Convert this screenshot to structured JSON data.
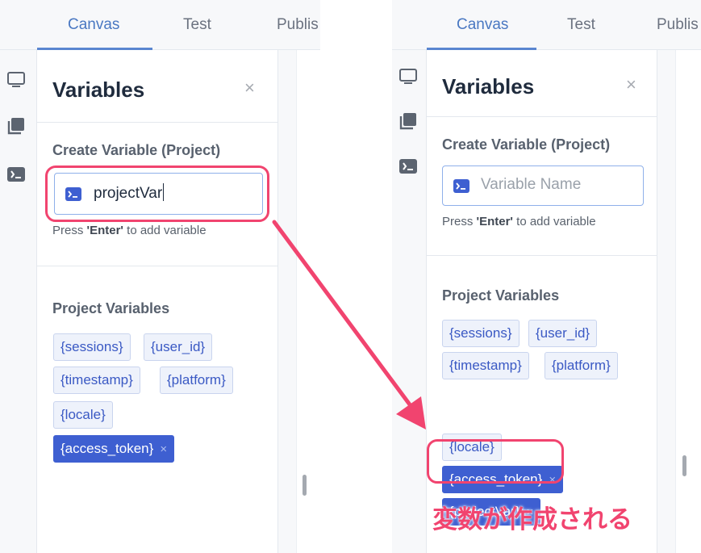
{
  "tabs": [
    "Canvas",
    "Test",
    "Publis"
  ],
  "sidebar": {
    "title": "Variables",
    "close_symbol": "×",
    "create_label": "Create Variable (Project)",
    "hint_prefix": "Press ",
    "hint_key": "'Enter'",
    "hint_suffix": " to add variable",
    "project_label": "Project Variables"
  },
  "before": {
    "input_value": "projectVar",
    "variables": [
      "{sessions}",
      "{user_id}",
      "{timestamp}",
      "{platform}",
      "{locale}"
    ],
    "new_variables": [
      "{access_token}"
    ]
  },
  "after": {
    "input_placeholder": "Variable Name",
    "variables": [
      "{sessions}",
      "{user_id}",
      "{timestamp}",
      "{platform}",
      "{locale}"
    ],
    "new_variables": [
      "{access_token}",
      "{projectVar}"
    ]
  },
  "chip_remove_symbol": "×",
  "annotation": "変数が作成される",
  "icons": {
    "rail": [
      "monitor-icon",
      "stack-icon",
      "terminal-icon"
    ],
    "input": "terminal-icon",
    "close": "close-icon",
    "remove": "remove-chip-icon"
  },
  "colors": {
    "accent": "#5a86d0",
    "chip_bg": "#eef2fb",
    "chip_text": "#3a59c4",
    "chip_solid": "#3e5fd1",
    "annotation": "#f1446f"
  }
}
